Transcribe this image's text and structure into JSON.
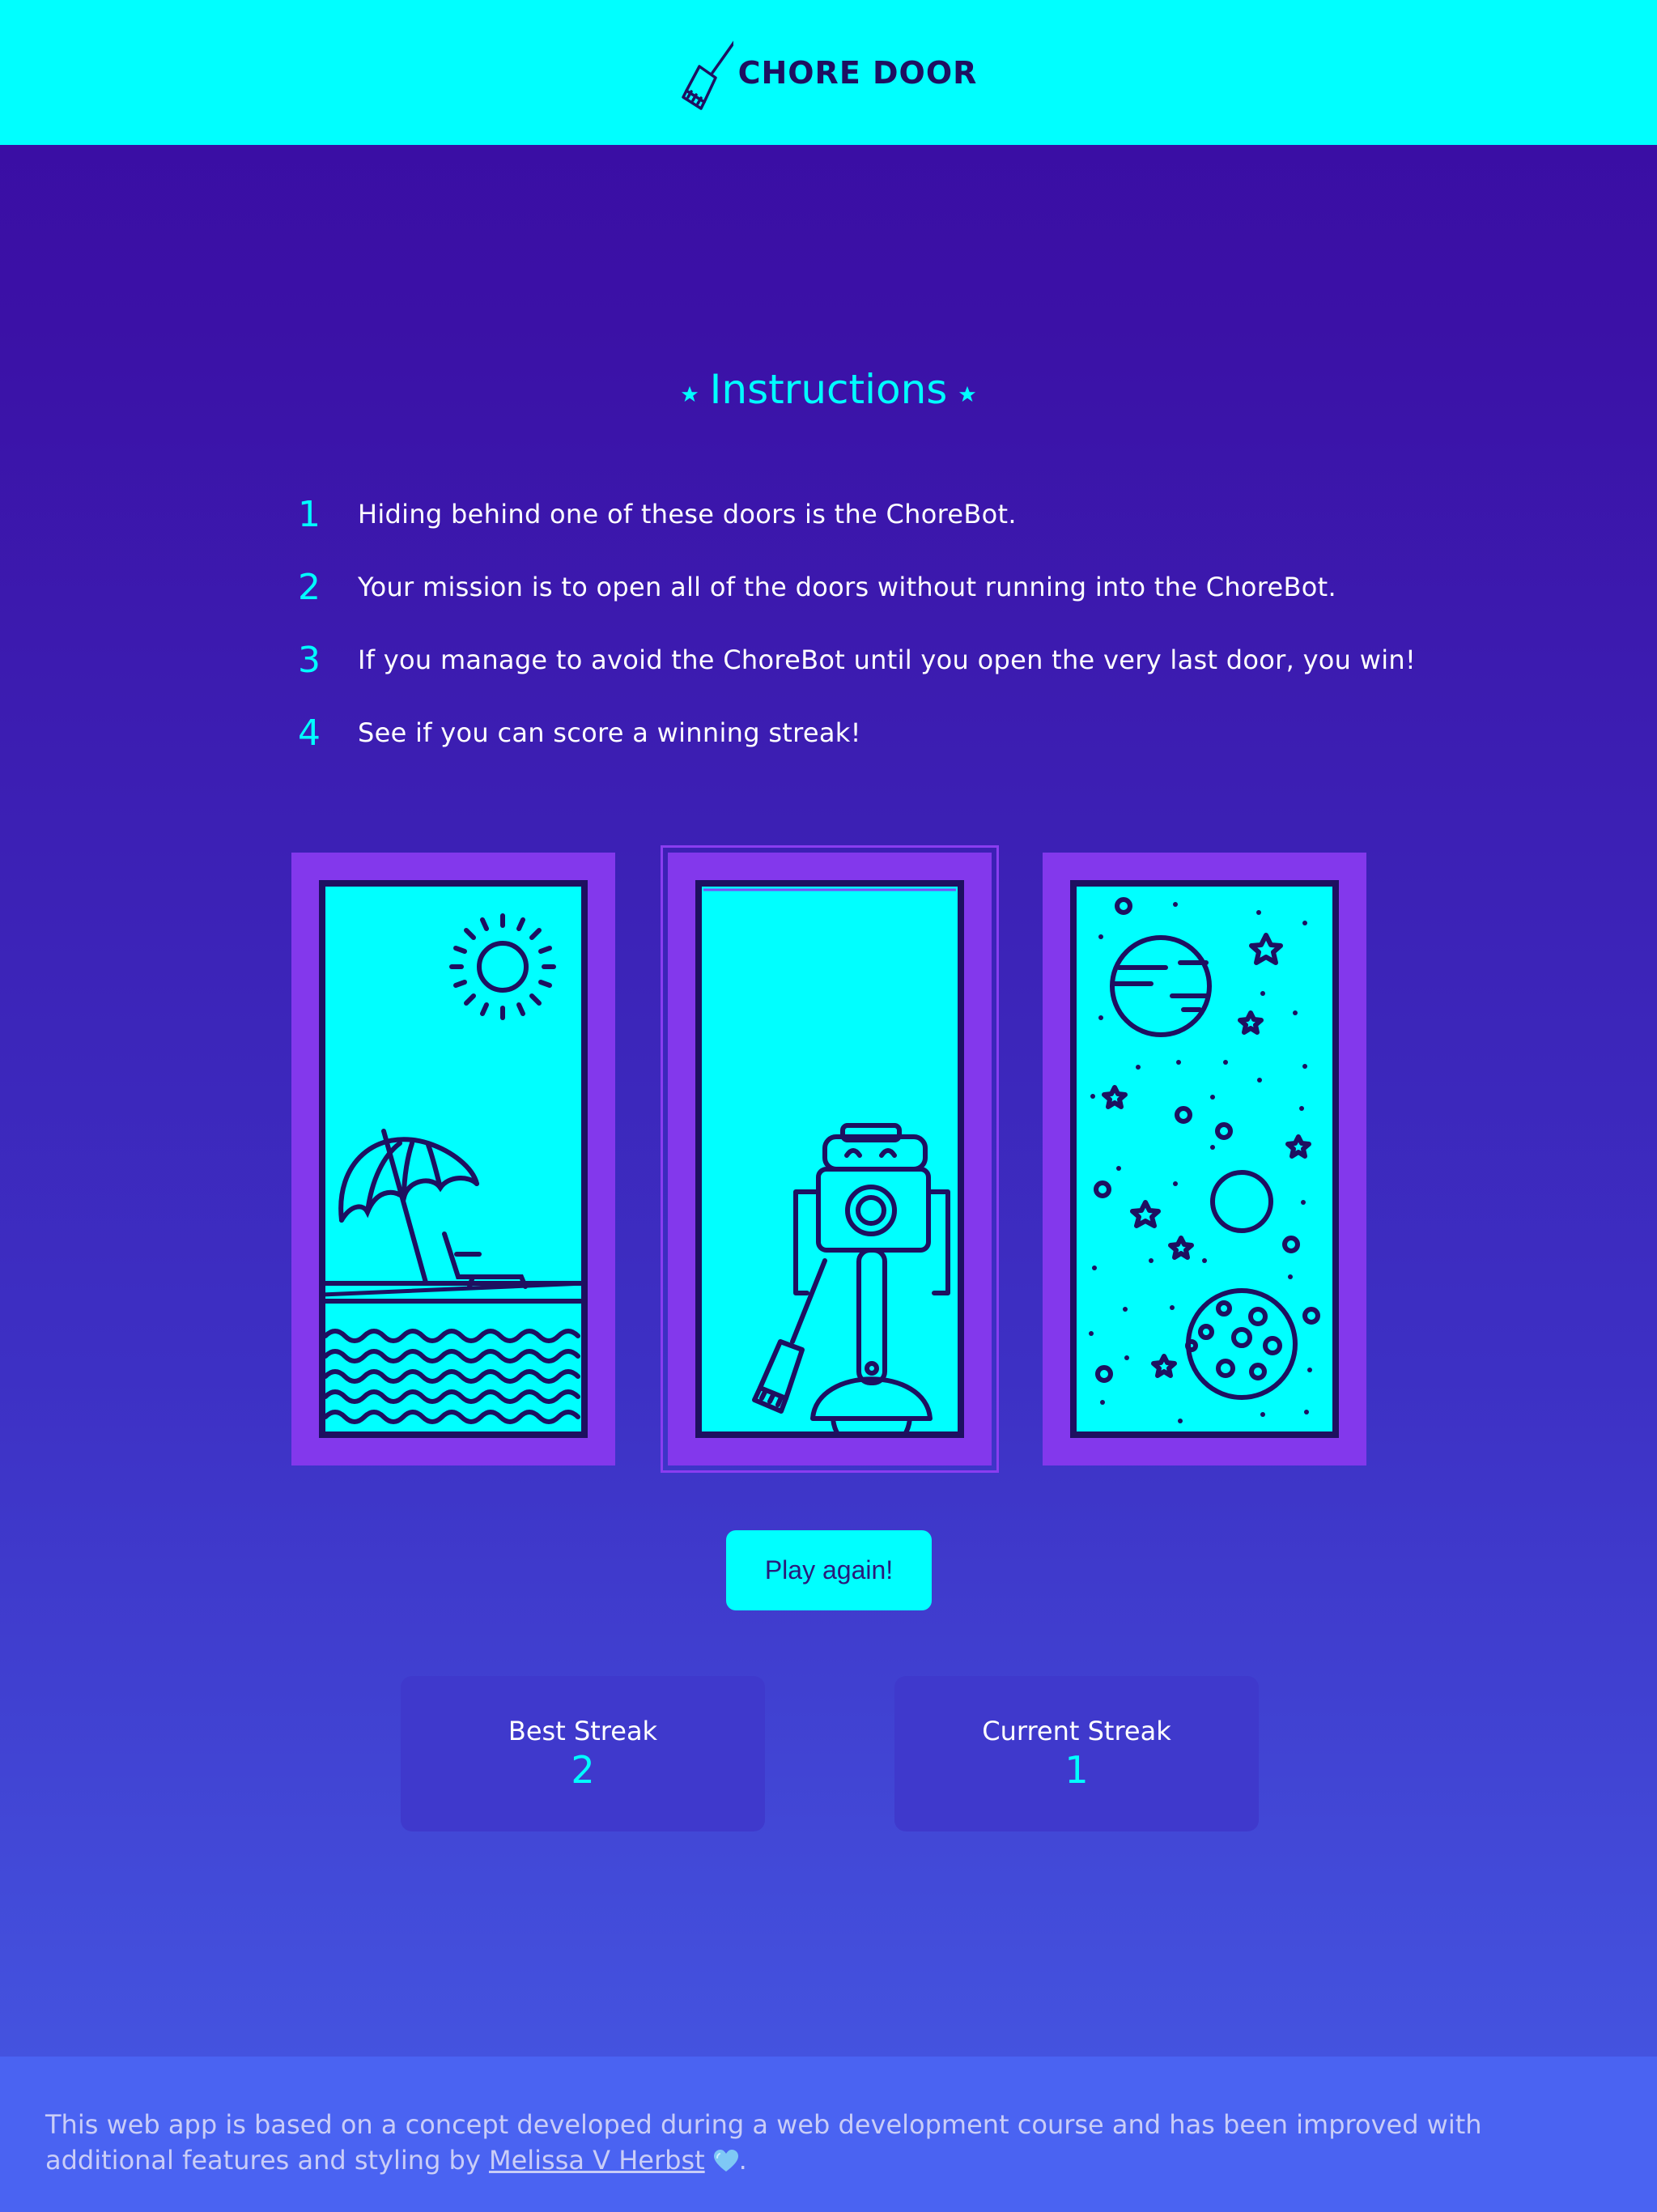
{
  "header": {
    "logo_icon": "broom-icon",
    "title": "CHORE DOOR"
  },
  "instructions": {
    "title": "Instructions",
    "icon": "star-icon",
    "steps": [
      {
        "number": "1",
        "text": "Hiding behind one of these doors is the ChoreBot."
      },
      {
        "number": "2",
        "text": "Your mission is to open all of the doors without running into the ChoreBot."
      },
      {
        "number": "3",
        "text": "If you manage to avoid the ChoreBot until you open the very last door, you win!"
      },
      {
        "number": "4",
        "text": "See if you can score a winning streak!"
      }
    ]
  },
  "doors": [
    {
      "scene": "beach",
      "state": "open"
    },
    {
      "scene": "chorebot",
      "state": "open"
    },
    {
      "scene": "space",
      "state": "open"
    }
  ],
  "play_button": {
    "label": "Play again!"
  },
  "streaks": {
    "best": {
      "label": "Best Streak",
      "value": "2"
    },
    "current": {
      "label": "Current Streak",
      "value": "1"
    }
  },
  "footer": {
    "text_before": "This web app is based on a concept developed during a web development course and has been improved with additional features and styling by ",
    "author": "Melissa V Herbst",
    "text_after": "."
  },
  "colors": {
    "accent": "#00ffff",
    "door_frame": "#8338ec",
    "background_top": "#3a0ca3",
    "background_bottom": "#4453df",
    "ink": "#1e1060"
  }
}
